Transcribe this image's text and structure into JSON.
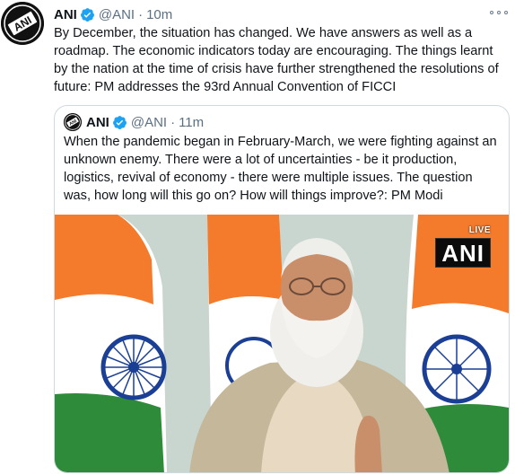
{
  "tweet": {
    "name": "ANI",
    "handle": "@ANI",
    "separator": "·",
    "time": "10m",
    "text": "By December, the situation has changed. We have answers as well as a roadmap. The economic indicators today are encouraging. The things learnt by the nation at the time of crisis have further strengthened the resolutions of future: PM addresses the 93rd Annual Convention of FICCI"
  },
  "quote": {
    "name": "ANI",
    "handle": "@ANI",
    "separator": "·",
    "time": "11m",
    "text": "When the pandemic began in February-March, we were fighting against an unknown enemy. There were a lot of uncertainties - be it production, logistics, revival of economy - there were multiple issues. The question was, how long will this go on? How will things improve?: PM Modi",
    "media": {
      "live_label": "LIVE",
      "watermark": "ANI"
    }
  },
  "icons": [
    "ani-logo-avatar",
    "verified-badge-icon",
    "more-options-icon"
  ],
  "colors": {
    "verified": "#1da1f2",
    "secondary_text": "#5b7083",
    "saffron": "#f47a2c",
    "india_green": "#2e8b3a",
    "chakra_blue": "#1b3f94"
  }
}
